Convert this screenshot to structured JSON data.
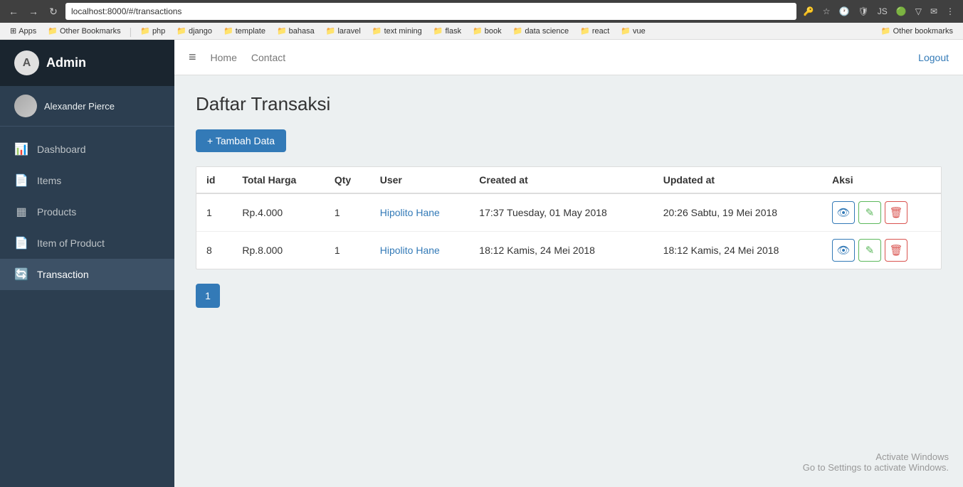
{
  "browser": {
    "url": "localhost:8000/#/transactions",
    "back": "‹",
    "forward": "›",
    "reload": "↻",
    "bookmarks": [
      {
        "label": "Apps",
        "icon": "⊞"
      },
      {
        "label": "Other Bookmarks",
        "icon": "📁"
      },
      {
        "label": "php",
        "icon": "📁"
      },
      {
        "label": "django",
        "icon": "📁"
      },
      {
        "label": "template",
        "icon": "📁"
      },
      {
        "label": "bahasa",
        "icon": "📁"
      },
      {
        "label": "laravel",
        "icon": "📁"
      },
      {
        "label": "text mining",
        "icon": "📁"
      },
      {
        "label": "flask",
        "icon": "📁"
      },
      {
        "label": "book",
        "icon": "📁"
      },
      {
        "label": "data science",
        "icon": "📁"
      },
      {
        "label": "react",
        "icon": "📁"
      },
      {
        "label": "vue",
        "icon": "📁"
      },
      {
        "label": "Other bookmarks",
        "icon": "📁"
      }
    ]
  },
  "sidebar": {
    "brand": "Admin",
    "user": {
      "name": "Alexander Pierce"
    },
    "nav": [
      {
        "label": "Dashboard",
        "icon": "📊",
        "id": "dashboard"
      },
      {
        "label": "Items",
        "icon": "📄",
        "id": "items"
      },
      {
        "label": "Products",
        "icon": "▦",
        "id": "products"
      },
      {
        "label": "Item of Product",
        "icon": "📄",
        "id": "item-of-product"
      },
      {
        "label": "Transaction",
        "icon": "🔄",
        "id": "transaction",
        "active": true
      }
    ]
  },
  "topnav": {
    "hamburger": "≡",
    "links": [
      "Home",
      "Contact"
    ],
    "logout": "Logout"
  },
  "page": {
    "title": "Daftar Transaksi",
    "add_button": "+ Tambah Data",
    "table": {
      "headers": [
        "id",
        "Total Harga",
        "Qty",
        "User",
        "Created at",
        "Updated at",
        "Aksi"
      ],
      "rows": [
        {
          "id": "1",
          "total_harga": "Rp.4.000",
          "qty": "1",
          "user": "Hipolito Hane",
          "created_at": "17:37 Tuesday, 01 May 2018",
          "updated_at": "20:26 Sabtu, 19 Mei 2018"
        },
        {
          "id": "8",
          "total_harga": "Rp.8.000",
          "qty": "1",
          "user": "Hipolito Hane",
          "created_at": "18:12 Kamis, 24 Mei 2018",
          "updated_at": "18:12 Kamis, 24 Mei 2018"
        }
      ]
    },
    "pagination": {
      "current": "1"
    }
  },
  "watermark": {
    "line1": "Activate Windows",
    "line2": "Go to Settings to activate Windows."
  }
}
